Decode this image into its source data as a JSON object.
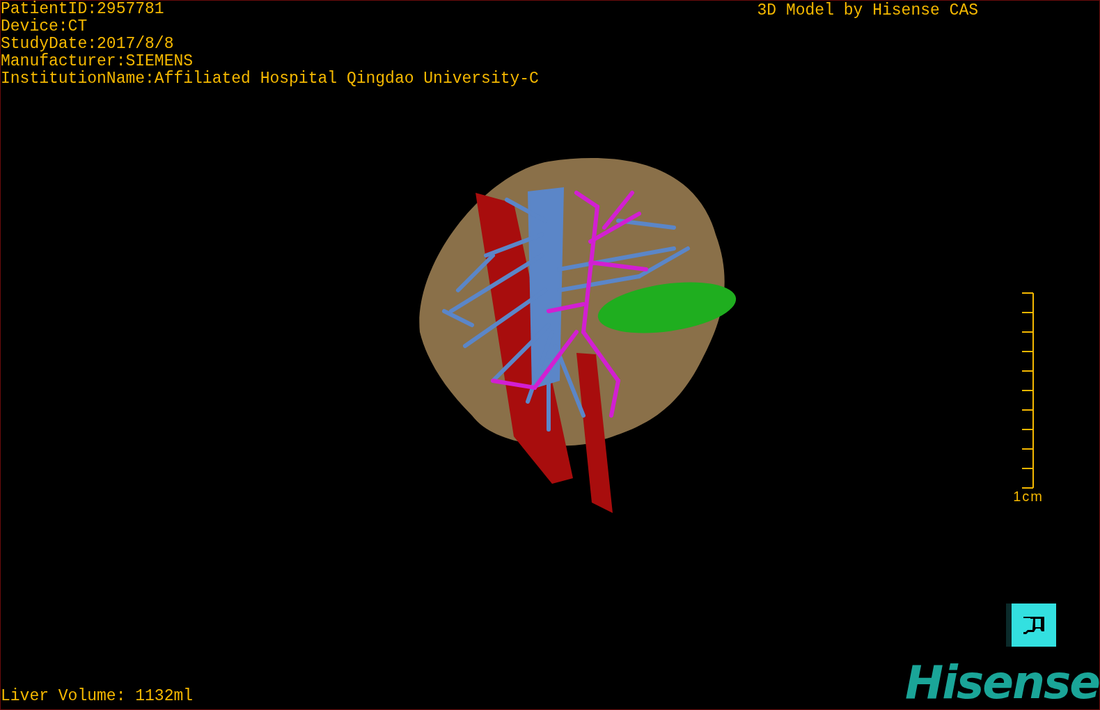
{
  "info_lines": [
    "PatientID:2957781",
    "Device:CT",
    "StudyDate:2017/8/8",
    "Manufacturer:SIEMENS",
    "InstitutionName:Affiliated Hospital Qingdao University-C"
  ],
  "title": "3D Model by Hisense CAS",
  "scale_label": "1cm",
  "liver_volume": "Liver Volume: 1132ml",
  "logo": "Hisense"
}
